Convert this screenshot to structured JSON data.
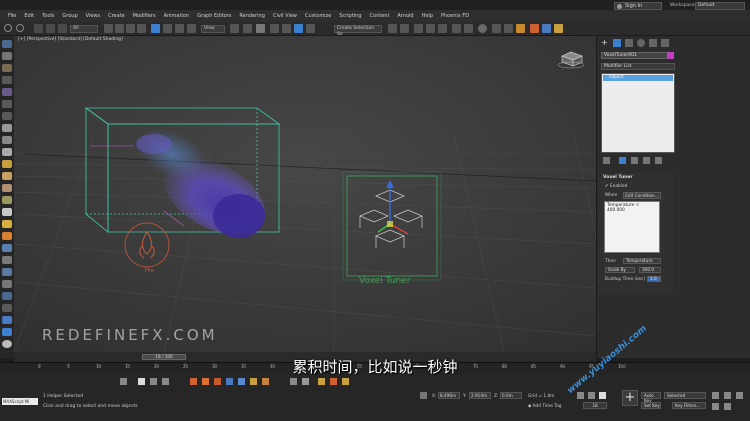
{
  "menubar": {
    "items": [
      "File",
      "Edit",
      "Tools",
      "Group",
      "Views",
      "Create",
      "Modifiers",
      "Animation",
      "Graph Editors",
      "Rendering",
      "Civil View",
      "Customize",
      "Scripting",
      "Content",
      "Arnold",
      "Help",
      "Phoenix FD"
    ],
    "signin": "Sign In",
    "workspace_label": "Workspaces:",
    "workspace_value": "Default"
  },
  "toolbar": {
    "selection_filter": "All",
    "reference_coord": "View",
    "create_selection_set": "Create Selection Se"
  },
  "viewport": {
    "label": "[+] [Perspective] [Standard] [Default Shading]",
    "watermark": "REDEFINEFX.COM",
    "fire_label": "Fire",
    "voxel_label": "Voxel Tuner"
  },
  "subtitle": "累积时间，比如说一秒钟",
  "site_watermark": "www.yuyiaoshi.com",
  "cmdpanel": {
    "object_name": "VoxelTuner001",
    "object_color": "#c040c0",
    "modifier_list": "Modifier List",
    "stack_item": "Object",
    "rollout_title": "Voxel Tuner",
    "enabled_label": "Enabled",
    "when_label": "When",
    "edit_condition": "Edit Condition...",
    "condition_text": "Temperature < 400.000",
    "then_label": "Then",
    "then_value": "Temperature",
    "op_value": "Scale By",
    "op_amount": "300.0",
    "buildup_label": "Buildup Time (sec)",
    "buildup_value": "1.0"
  },
  "timeline": {
    "slider": "18 / 100",
    "ticks": [
      "0",
      "5",
      "10",
      "15",
      "20",
      "25",
      "30",
      "35",
      "40",
      "45",
      "50",
      "55",
      "60",
      "65",
      "70",
      "75",
      "80",
      "85",
      "90",
      "95",
      "100"
    ]
  },
  "status": {
    "script": "MAXScript Mi",
    "line1": "1 Helper Selected",
    "line2": "Click and drag to select and move objects",
    "x_label": "X:",
    "x_value": "8.496m",
    "y_label": "Y:",
    "y_value": "2.914m",
    "z_label": "Z:",
    "z_value": "0.0m",
    "grid_label": "Grid = 1.0m",
    "add_time_tag": "Add Time Tag",
    "auto_key": "Auto Key",
    "set_key": "Set Key",
    "selected": "Selected",
    "key_filters": "Key Filters...",
    "frame": "18"
  }
}
